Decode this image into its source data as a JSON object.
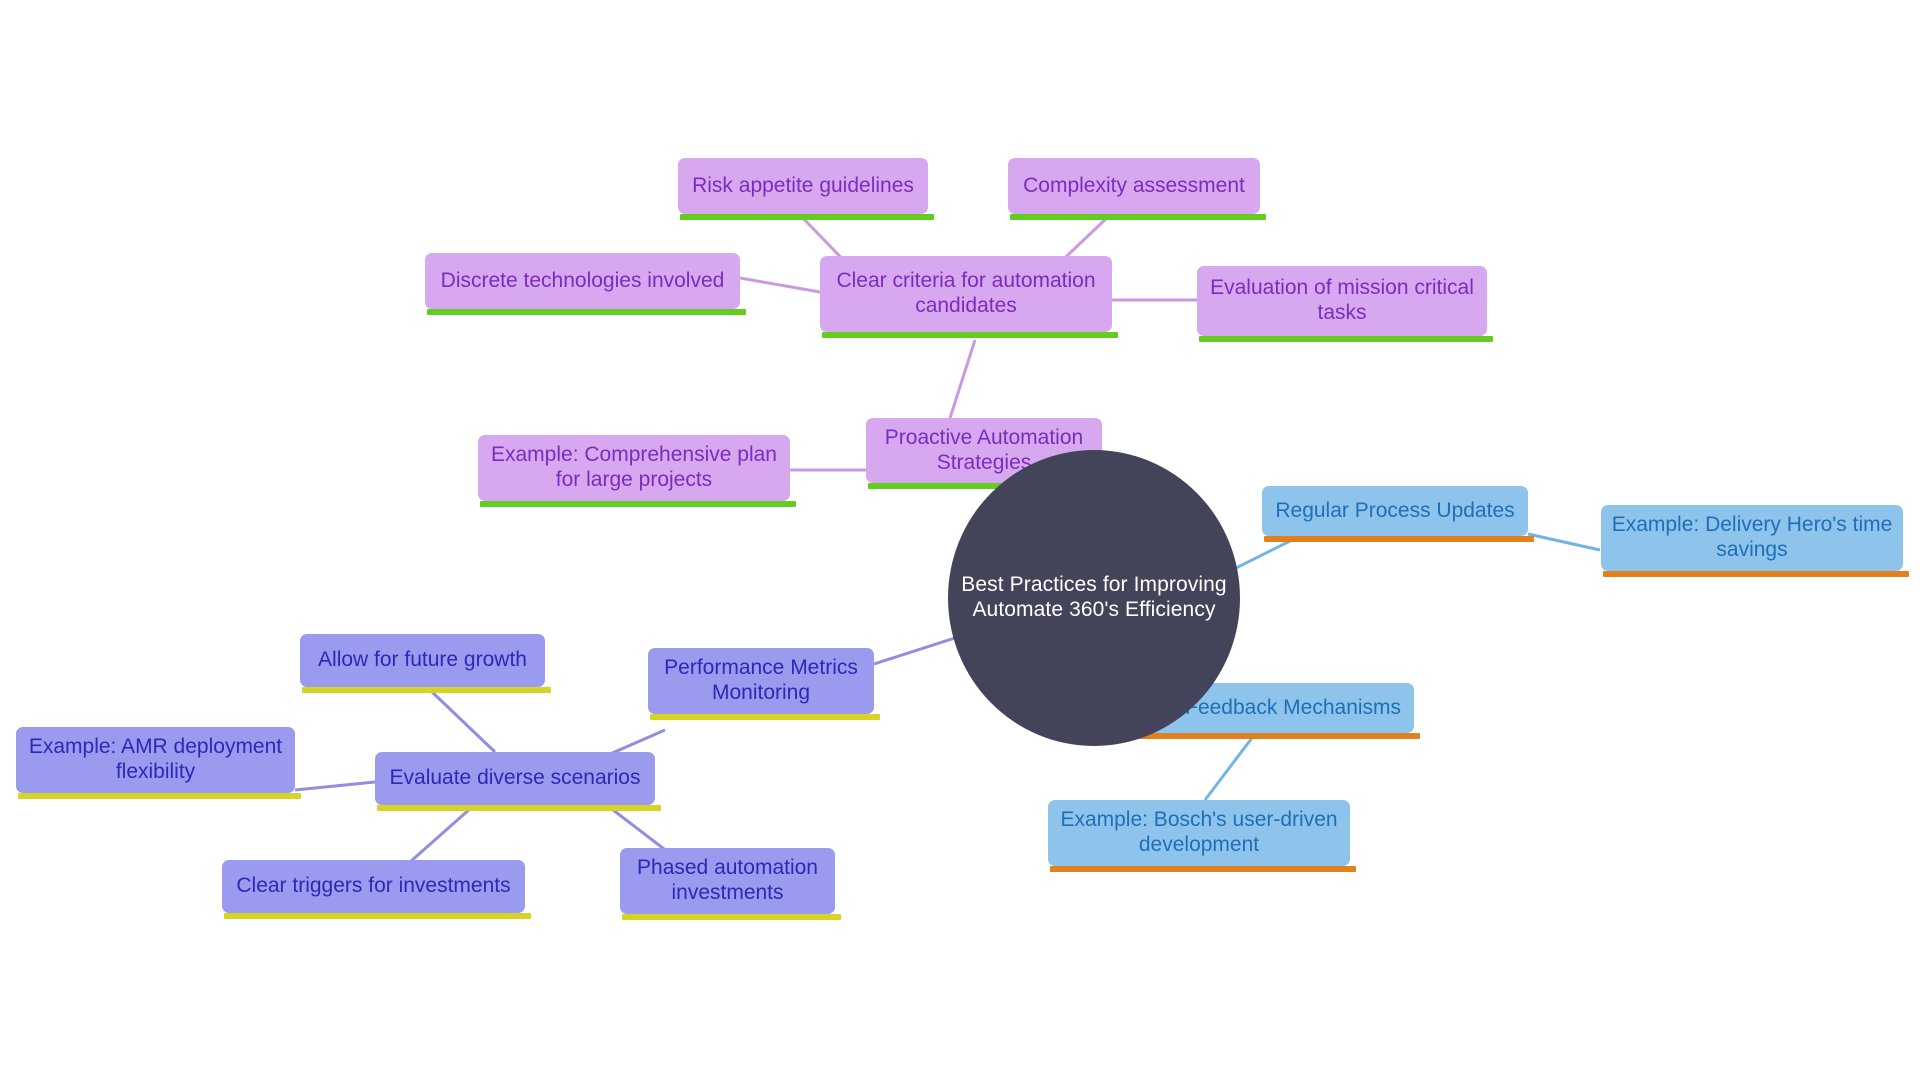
{
  "diagram": {
    "type": "mind-map",
    "title": "Best Practices for Improving Automate 360's Efficiency",
    "background": "#ffffff",
    "palette": {
      "root_fill": "#434459",
      "root_text": "#ffffff",
      "purple_fill": "#d7a7ef",
      "purple_text": "#7b2cbf",
      "purple_accent": "#63cc21",
      "periwinkle_fill": "#9a9aee",
      "periwinkle_text": "#2a2ab8",
      "periwinkle_accent": "#d7d426",
      "blue_fill": "#8ec4ec",
      "blue_text": "#1f6fb8",
      "blue_accent": "#e2801e"
    }
  },
  "root": {
    "label": "Best Practices for Improving\nAutomate 360's Efficiency"
  },
  "nodes": {
    "proactive_automation_strategies": {
      "label": "Proactive Automation\nStrategies"
    },
    "example_comprehensive_plan": {
      "label": "Example: Comprehensive plan\nfor large projects"
    },
    "clear_criteria": {
      "label": "Clear criteria for automation\ncandidates"
    },
    "risk_appetite_guidelines": {
      "label": "Risk appetite guidelines"
    },
    "complexity_assessment": {
      "label": "Complexity assessment"
    },
    "discrete_technologies": {
      "label": "Discrete technologies involved"
    },
    "evaluation_mission_critical": {
      "label": "Evaluation of mission critical\ntasks"
    },
    "performance_metrics_monitoring": {
      "label": "Performance Metrics\nMonitoring"
    },
    "evaluate_diverse_scenarios": {
      "label": "Evaluate diverse scenarios"
    },
    "allow_future_growth": {
      "label": "Allow for future growth"
    },
    "example_amr_deployment": {
      "label": "Example: AMR deployment\nflexibility"
    },
    "clear_triggers_investments": {
      "label": "Clear triggers for investments"
    },
    "phased_automation_investments": {
      "label": "Phased automation\ninvestments"
    },
    "regular_process_updates": {
      "label": "Regular Process Updates"
    },
    "example_delivery_hero": {
      "label": "Example: Delivery Hero's time\nsavings"
    },
    "user_feedback_mechanisms": {
      "label": "User Feedback Mechanisms"
    },
    "example_bosch": {
      "label": "Example: Bosch's user-driven\ndevelopment"
    }
  },
  "edges": [
    {
      "from": "root",
      "to": "proactive_automation_strategies",
      "color": "#c99ae0"
    },
    {
      "from": "proactive_automation_strategies",
      "to": "example_comprehensive_plan",
      "color": "#c99ae0"
    },
    {
      "from": "proactive_automation_strategies",
      "to": "clear_criteria",
      "color": "#c99ae0"
    },
    {
      "from": "clear_criteria",
      "to": "risk_appetite_guidelines",
      "color": "#c99ae0"
    },
    {
      "from": "clear_criteria",
      "to": "complexity_assessment",
      "color": "#c99ae0"
    },
    {
      "from": "clear_criteria",
      "to": "discrete_technologies",
      "color": "#c99ae0"
    },
    {
      "from": "clear_criteria",
      "to": "evaluation_mission_critical",
      "color": "#c99ae0"
    },
    {
      "from": "root",
      "to": "performance_metrics_monitoring",
      "color": "#8f8fe0"
    },
    {
      "from": "performance_metrics_monitoring",
      "to": "evaluate_diverse_scenarios",
      "color": "#8f8fe0"
    },
    {
      "from": "evaluate_diverse_scenarios",
      "to": "allow_future_growth",
      "color": "#8f8fe0"
    },
    {
      "from": "evaluate_diverse_scenarios",
      "to": "example_amr_deployment",
      "color": "#8f8fe0"
    },
    {
      "from": "evaluate_diverse_scenarios",
      "to": "clear_triggers_investments",
      "color": "#8f8fe0"
    },
    {
      "from": "evaluate_diverse_scenarios",
      "to": "phased_automation_investments",
      "color": "#8f8fe0"
    },
    {
      "from": "root",
      "to": "regular_process_updates",
      "color": "#71b5e2"
    },
    {
      "from": "regular_process_updates",
      "to": "example_delivery_hero",
      "color": "#71b5e2"
    },
    {
      "from": "root",
      "to": "user_feedback_mechanisms",
      "color": "#71b5e2"
    },
    {
      "from": "user_feedback_mechanisms",
      "to": "example_bosch",
      "color": "#71b5e2"
    }
  ]
}
